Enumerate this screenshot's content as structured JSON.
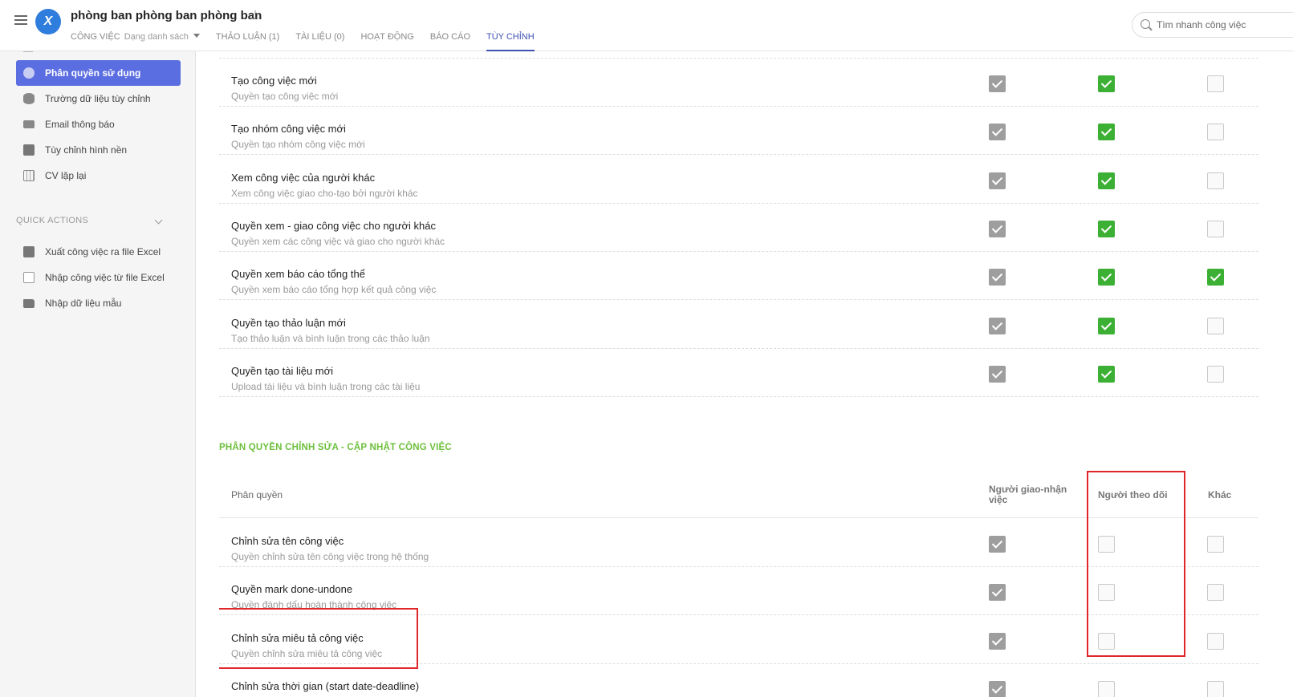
{
  "header": {
    "project_title": "phòng ban phòng ban phòng ban",
    "logo_text": "X",
    "tabs": [
      {
        "label": "CÔNG VIỆC",
        "sub": "Dạng danh sách"
      },
      {
        "label": "THẢO LUẬN (1)"
      },
      {
        "label": "TÀI LIỆU (0)"
      },
      {
        "label": "HOẠT ĐỘNG"
      },
      {
        "label": "BÁO CÁO"
      },
      {
        "label": "TÙY CHỈNH"
      }
    ],
    "search_placeholder": "Tìm nhanh công việc"
  },
  "sidebar": {
    "items": [
      {
        "label": "Phân quyền sử dụng",
        "icon": "permission-icon",
        "active": true
      },
      {
        "label": "Trường dữ liệu tùy chỉnh",
        "icon": "database-icon"
      },
      {
        "label": "Email thông báo",
        "icon": "mail-icon"
      },
      {
        "label": "Tùy chỉnh hình nền",
        "icon": "edit-icon"
      },
      {
        "label": "CV lặp lại",
        "icon": "calendar-icon"
      }
    ],
    "quick_actions_title": "QUICK ACTIONS",
    "quick_actions": [
      {
        "label": "Xuất công việc ra file Excel",
        "icon": "export-icon"
      },
      {
        "label": "Nhập công việc từ file Excel",
        "icon": "excel-icon"
      },
      {
        "label": "Nhập dữ liệu mẫu",
        "icon": "folder-icon"
      }
    ]
  },
  "permissions_top": [
    {
      "title": "Tạo công việc mới",
      "desc": "Quyền tạo công việc mới",
      "c1": true,
      "c2": true,
      "c3": false
    },
    {
      "title": "Tạo nhóm công việc mới",
      "desc": "Quyền tạo nhóm công việc mới",
      "c1": true,
      "c2": true,
      "c3": false
    },
    {
      "title": "Xem công việc của người khác",
      "desc": "Xem công việc giao cho-tạo bởi người khác",
      "c1": true,
      "c2": true,
      "c3": false
    },
    {
      "title": "Quyền xem - giao công việc cho người khác",
      "desc": "Quyền xem các công việc và giao cho người khác",
      "c1": true,
      "c2": true,
      "c3": false
    },
    {
      "title": "Quyền xem báo cáo tổng thể",
      "desc": "Quyền xem báo cáo tổng hợp kết quả công việc",
      "c1": true,
      "c2": true,
      "c3": true
    },
    {
      "title": "Quyền tạo thảo luận mới",
      "desc": "Tạo thảo luận và bình luận trong các thảo luận",
      "c1": true,
      "c2": true,
      "c3": false
    },
    {
      "title": "Quyền tạo tài liệu mới",
      "desc": "Upload tài liệu và bình luận trong các tài liệu",
      "c1": true,
      "c2": true,
      "c3": false
    }
  ],
  "edit_section": {
    "title": "PHÂN QUYỀN CHỈNH SỬA - CẬP NHẬT CÔNG VIỆC",
    "columns": {
      "permission": "Phân quyền",
      "assigner": "Người giao-nhận việc",
      "follower": "Người theo dõi",
      "other": "Khác"
    },
    "rows": [
      {
        "title": "Chỉnh sửa tên công việc",
        "desc": "Quyền chỉnh sửa tên công việc trong hệ thống",
        "c1": true,
        "c2": false,
        "c3": false
      },
      {
        "title": "Quyền mark done-undone",
        "desc": "Quyền đánh dấu hoàn thành công việc",
        "c1": true,
        "c2": false,
        "c3": false
      },
      {
        "title": "Chỉnh sửa miêu tả công việc",
        "desc": "Quyền chỉnh sửa miêu tả công việc",
        "c1": true,
        "c2": false,
        "c3": false
      },
      {
        "title": "Chỉnh sửa thời gian (start date-deadline)",
        "desc": "",
        "c1": true,
        "c2": false,
        "c3": false
      }
    ]
  },
  "colors": {
    "accent": "#3f51b5",
    "sidebar_active": "#5b6ee1",
    "check_green": "#3cb034",
    "check_gray": "#9e9e9e",
    "section_green": "#6cbf3b",
    "highlight_red": "#e0262b"
  }
}
